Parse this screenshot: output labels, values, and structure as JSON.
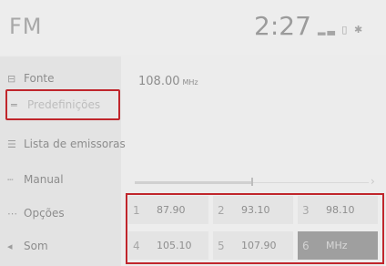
{
  "header": {
    "title": "FM",
    "clock": "2:27",
    "status_icons": [
      "signal-icon",
      "phone-icon",
      "bluetooth-icon"
    ]
  },
  "sidebar": {
    "items": [
      {
        "label": "Fonte",
        "icon": "source-icon",
        "glyph": "⊟"
      },
      {
        "label": "Predefinições",
        "icon": "presets-icon",
        "glyph": "═",
        "selected": true
      },
      {
        "label": "Lista de emissoras",
        "icon": "station-list-icon",
        "glyph": "☰"
      },
      {
        "label": "Manual",
        "icon": "manual-tune-icon",
        "glyph": "┄"
      },
      {
        "label": "Opções",
        "icon": "options-icon",
        "glyph": "⋯"
      },
      {
        "label": "Som",
        "icon": "sound-icon",
        "glyph": "◂"
      }
    ]
  },
  "main": {
    "frequency": "108.00",
    "unit": "MHz"
  },
  "pager": {
    "arrow": "›",
    "position": 0.5
  },
  "presets": [
    {
      "number": "1",
      "value": "87.90"
    },
    {
      "number": "2",
      "value": "93.10"
    },
    {
      "number": "3",
      "value": "98.10"
    },
    {
      "number": "4",
      "value": "105.10"
    },
    {
      "number": "5",
      "value": "107.90"
    },
    {
      "number": "6",
      "value": "MHz",
      "empty": true
    }
  ],
  "colors": {
    "highlight_border": "#c0262c"
  }
}
